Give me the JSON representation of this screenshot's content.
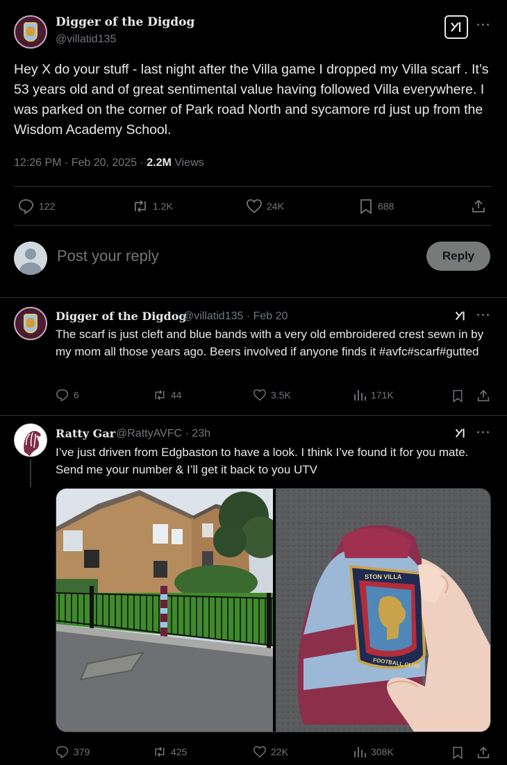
{
  "main_post": {
    "author_name": "Digger of the Digdog",
    "author_handle": "@villatid135",
    "text": "Hey X do your stuff - last night  after the Villa game I dropped my Villa scarf . It’s 53 years old and of great sentimental  value having followed Villa everywhere. I was parked on the corner of Park road North and sycamore rd just up from the Wisdom Academy School.",
    "time": "12:26 PM · Feb 20, 2025 · ",
    "views_count": "2.2M",
    "views_label": " Views",
    "replies": "122",
    "reposts": "1.2K",
    "likes": "24K",
    "bookmarks": "688"
  },
  "reply_box": {
    "placeholder": "Post your reply",
    "button_label": "Reply"
  },
  "replies": [
    {
      "author_name": "Digger of the Digdog",
      "author_handle": "@villatid135 · Feb 20",
      "text": "The scarf is just cleft and blue bands with a very old embroidered crest sewn in by my mom all those years ago. Beers involved if anyone finds it #avfc#scarf#gutted",
      "replies": "6",
      "reposts": "44",
      "likes": "3.5K",
      "views": "171K"
    },
    {
      "author_name": "Ratty Gar",
      "author_handle": "@RattyAVFC · 23h",
      "text": "I’ve just driven from Edgbaston to have a look. I think I’ve found it for you mate. Send me your number & I’ll get it back to you UTV",
      "replies": "379",
      "reposts": "425",
      "likes": "22K",
      "views": "308K",
      "crest_text_top": "STON VILLA",
      "crest_text_bottom": "FOOTBALL CLUB"
    }
  ],
  "icons": [
    "avatar-villa-crest",
    "grok-icon",
    "more-icon",
    "reply-icon",
    "repost-icon",
    "like-icon",
    "bookmark-icon",
    "share-icon",
    "views-icon"
  ],
  "colors": {
    "background": "#000000",
    "text": "#e7e9ea",
    "muted": "#71767b",
    "border": "#2f3336",
    "reply_button": "#787a7a"
  }
}
